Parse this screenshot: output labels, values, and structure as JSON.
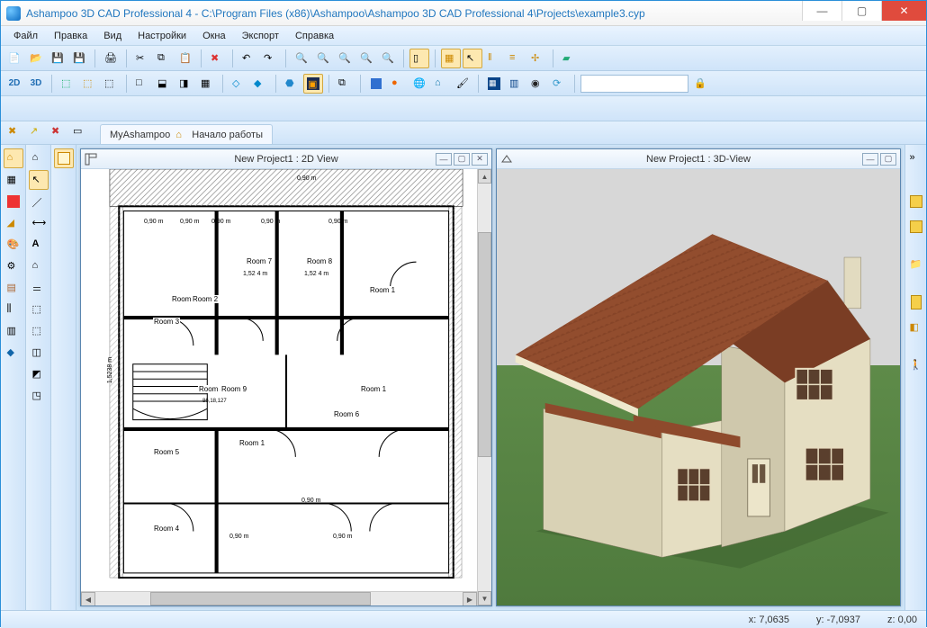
{
  "window": {
    "title": "Ashampoo 3D CAD Professional 4 - C:\\Program Files (x86)\\Ashampoo\\Ashampoo 3D CAD Professional 4\\Projects\\example3.cyp"
  },
  "menu": {
    "items": [
      "Файл",
      "Правка",
      "Вид",
      "Настройки",
      "Окна",
      "Экспорт",
      "Справка"
    ]
  },
  "tabs": {
    "t1": "MyAshampoo",
    "t2": "Начало работы"
  },
  "views": {
    "view2d_title": "New Project1 : 2D View",
    "view3d_title": "New Project1 : 3D-View"
  },
  "plan": {
    "rooms": {
      "room1": "Room 1",
      "room2": "Room 2",
      "room2b": "Room 2",
      "room3": "Room 3",
      "room4": "Room 4",
      "room4b": "Room 4",
      "room5": "Room 5",
      "room6": "Room 6",
      "room7": "Room 7",
      "room8": "Room 8",
      "room9": "Room 9",
      "room1b": "Room 1",
      "room1c": "Room 1"
    },
    "dims": {
      "d1": "0,90 m",
      "d2": "0,90 m",
      "d3": "0,90 m",
      "d4": "0,90 m",
      "d5": "0,90 m",
      "d6": "0,90 m",
      "d7": "0,90 m",
      "d8": "0,90 m",
      "d9": "0,90 m",
      "d10": "1,52 4 m",
      "d11": "1,52 4 m",
      "d12": "1,5238 m",
      "d13": "86,18,127"
    }
  },
  "status": {
    "x_label": "x: ",
    "x_value": "7,0635",
    "y_label": "y: ",
    "y_value": "-7,0937",
    "z_label": "z: ",
    "z_value": "0,00"
  }
}
